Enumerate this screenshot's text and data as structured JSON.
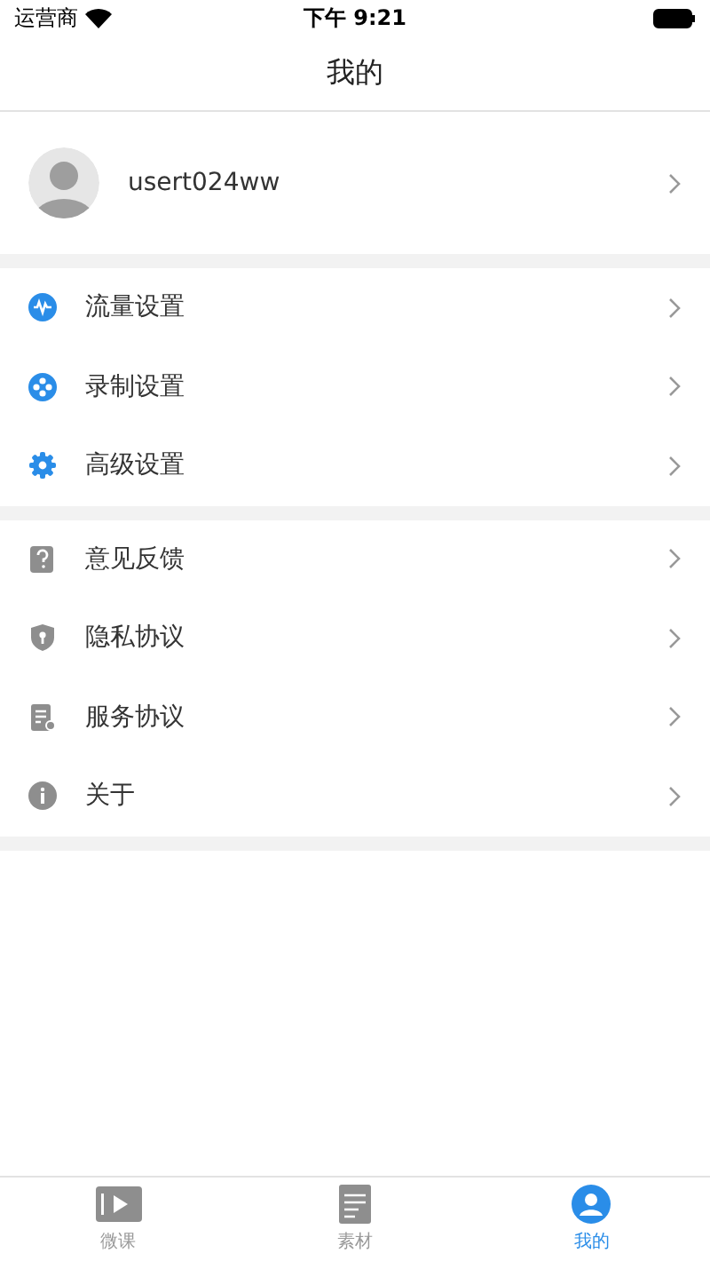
{
  "status_bar": {
    "carrier": "运营商",
    "time": "下午 9:21"
  },
  "nav_bar": {
    "title": "我的"
  },
  "profile": {
    "username": "usert024ww"
  },
  "menu_groups": [
    {
      "items": [
        {
          "kind": "traffic",
          "label": "流量设置"
        },
        {
          "kind": "record",
          "label": "录制设置"
        },
        {
          "kind": "advanced",
          "label": "高级设置"
        }
      ]
    },
    {
      "items": [
        {
          "kind": "feedback",
          "label": "意见反馈"
        },
        {
          "kind": "privacy",
          "label": "隐私协议"
        },
        {
          "kind": "service",
          "label": "服务协议"
        },
        {
          "kind": "about",
          "label": "关于"
        }
      ]
    }
  ],
  "tab_bar": [
    {
      "kind": "lesson",
      "label": "微课",
      "selected": false
    },
    {
      "kind": "material",
      "label": "素材",
      "selected": false
    },
    {
      "kind": "mine",
      "label": "我的",
      "selected": true
    }
  ]
}
